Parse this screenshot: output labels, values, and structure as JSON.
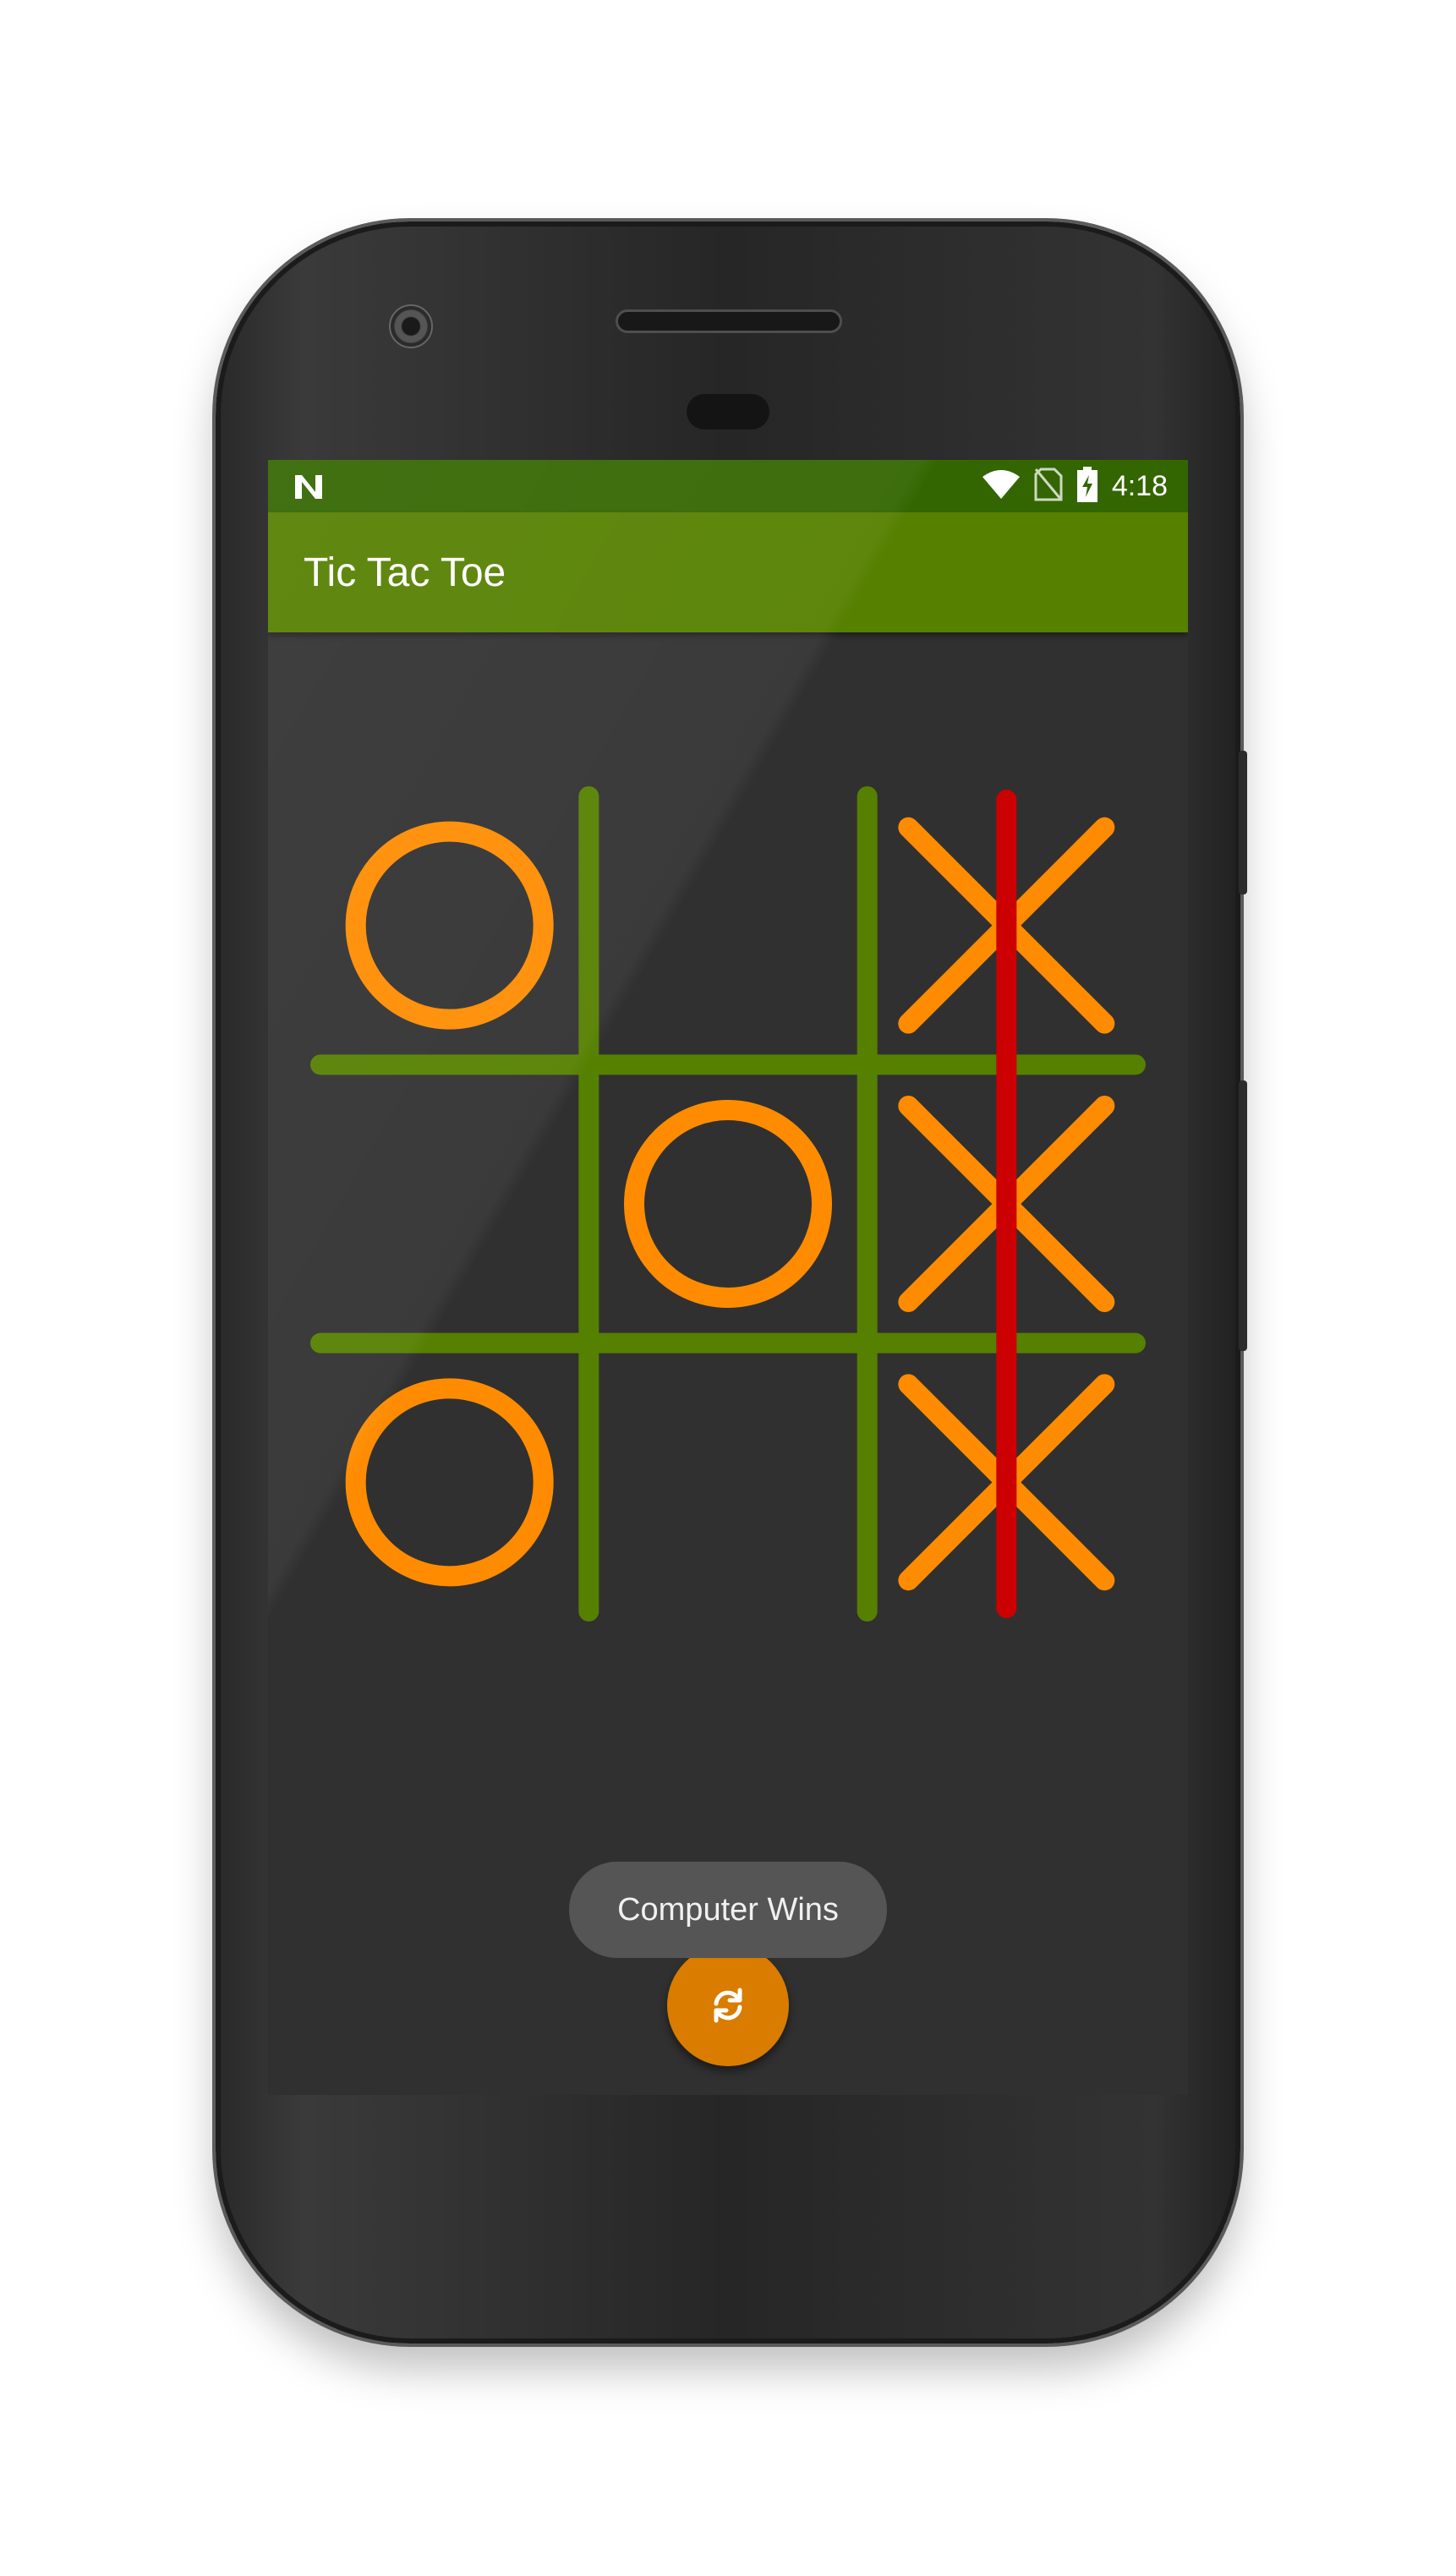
{
  "status_bar": {
    "time": "4:18",
    "icons": [
      "notification-n-icon",
      "wifi-icon",
      "no-sim-icon",
      "battery-charging-icon"
    ]
  },
  "app_bar": {
    "title": "Tic Tac Toe"
  },
  "board": {
    "cells": [
      [
        "O",
        "",
        "X"
      ],
      [
        "",
        "O",
        "X"
      ],
      [
        "O",
        "",
        "X"
      ]
    ],
    "winning_line": "column-3",
    "colors": {
      "grid": "#558000",
      "marks": "#ff8c00",
      "win_line": "#cc0000"
    }
  },
  "toast": {
    "message": "Computer Wins"
  },
  "fab": {
    "icon": "refresh-icon"
  },
  "colors": {
    "status_bar": "#336600",
    "app_bar": "#558000",
    "background": "#303030",
    "fab": "#d97c00"
  }
}
